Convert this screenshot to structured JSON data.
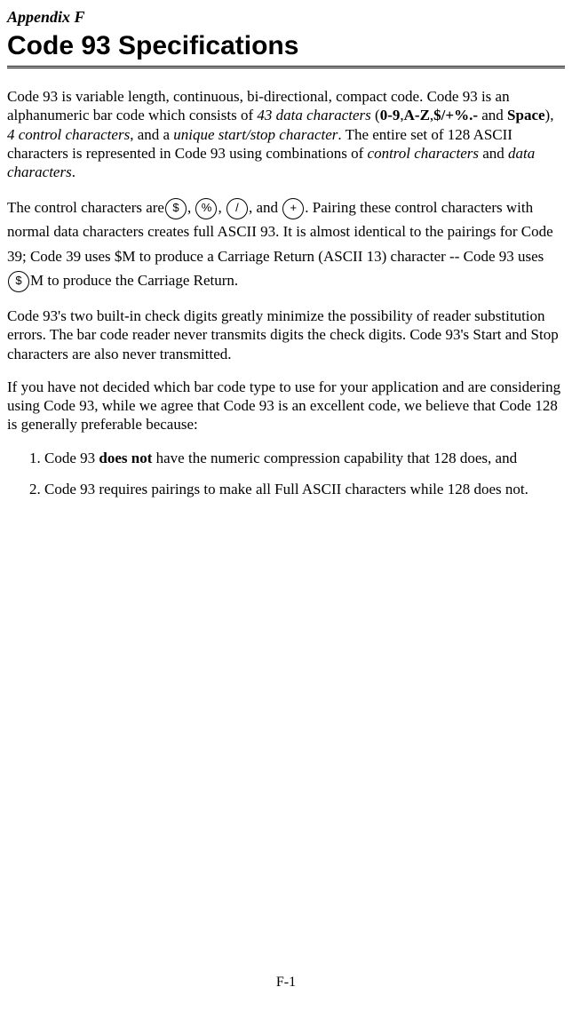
{
  "header": {
    "appendix_label": "Appendix F",
    "title": "Code 93 Specifications"
  },
  "para1": {
    "t1": "Code 93 is variable length, continuous, bi-directional, compact code.  Code 93 is an alphanumeric bar code which consists of ",
    "i1": "43 data characters",
    "t2": " (",
    "b1": "0-9",
    "t3": ",",
    "b2": "A-Z",
    "t4": ",",
    "b3": "$/+%.-",
    "t5": " and ",
    "b4": "Space",
    "t6": "), ",
    "i2": "4 control characters",
    "t7": ", and a ",
    "i3": "unique start/stop character",
    "t8": ".  The entire set of 128 ASCII characters is represented in Code 93 using combinations of ",
    "i4": "control characters",
    "t9": " and ",
    "i5": "data characters",
    "t10": "."
  },
  "para2": {
    "t1": "The control characters are",
    "icon1": "$",
    "t2": ", ",
    "icon2": "%",
    "t3": ", ",
    "icon3": "/",
    "t4": ", and ",
    "icon4": "+",
    "t5": ".  Pairing these control characters with normal data characters creates full ASCII 93.  It is almost identical to the pairings for Code 39; Code 39 uses $M to produce a Carriage Return (ASCII 13) character -- Code 93 uses ",
    "icon5": "$",
    "t6": "M to produce the Carriage Return."
  },
  "para3": "Code 93's two built-in check digits greatly minimize the possibility of reader substitution errors. The bar code reader never transmits digits the check digits.  Code 93's Start and Stop characters are also never transmitted.",
  "para4": "If you have not decided which bar code type to use for your application and are considering using Code 93, while we agree that Code 93 is an excellent code, we believe that Code 128 is generally preferable because:",
  "list": {
    "item1": {
      "t1": "Code 93 ",
      "b1": "does not",
      "t2": " have the numeric compression capability that 128 does, and"
    },
    "item2": "Code 93 requires pairings to make all Full ASCII characters while 128 does not."
  },
  "page_number": "F-1"
}
